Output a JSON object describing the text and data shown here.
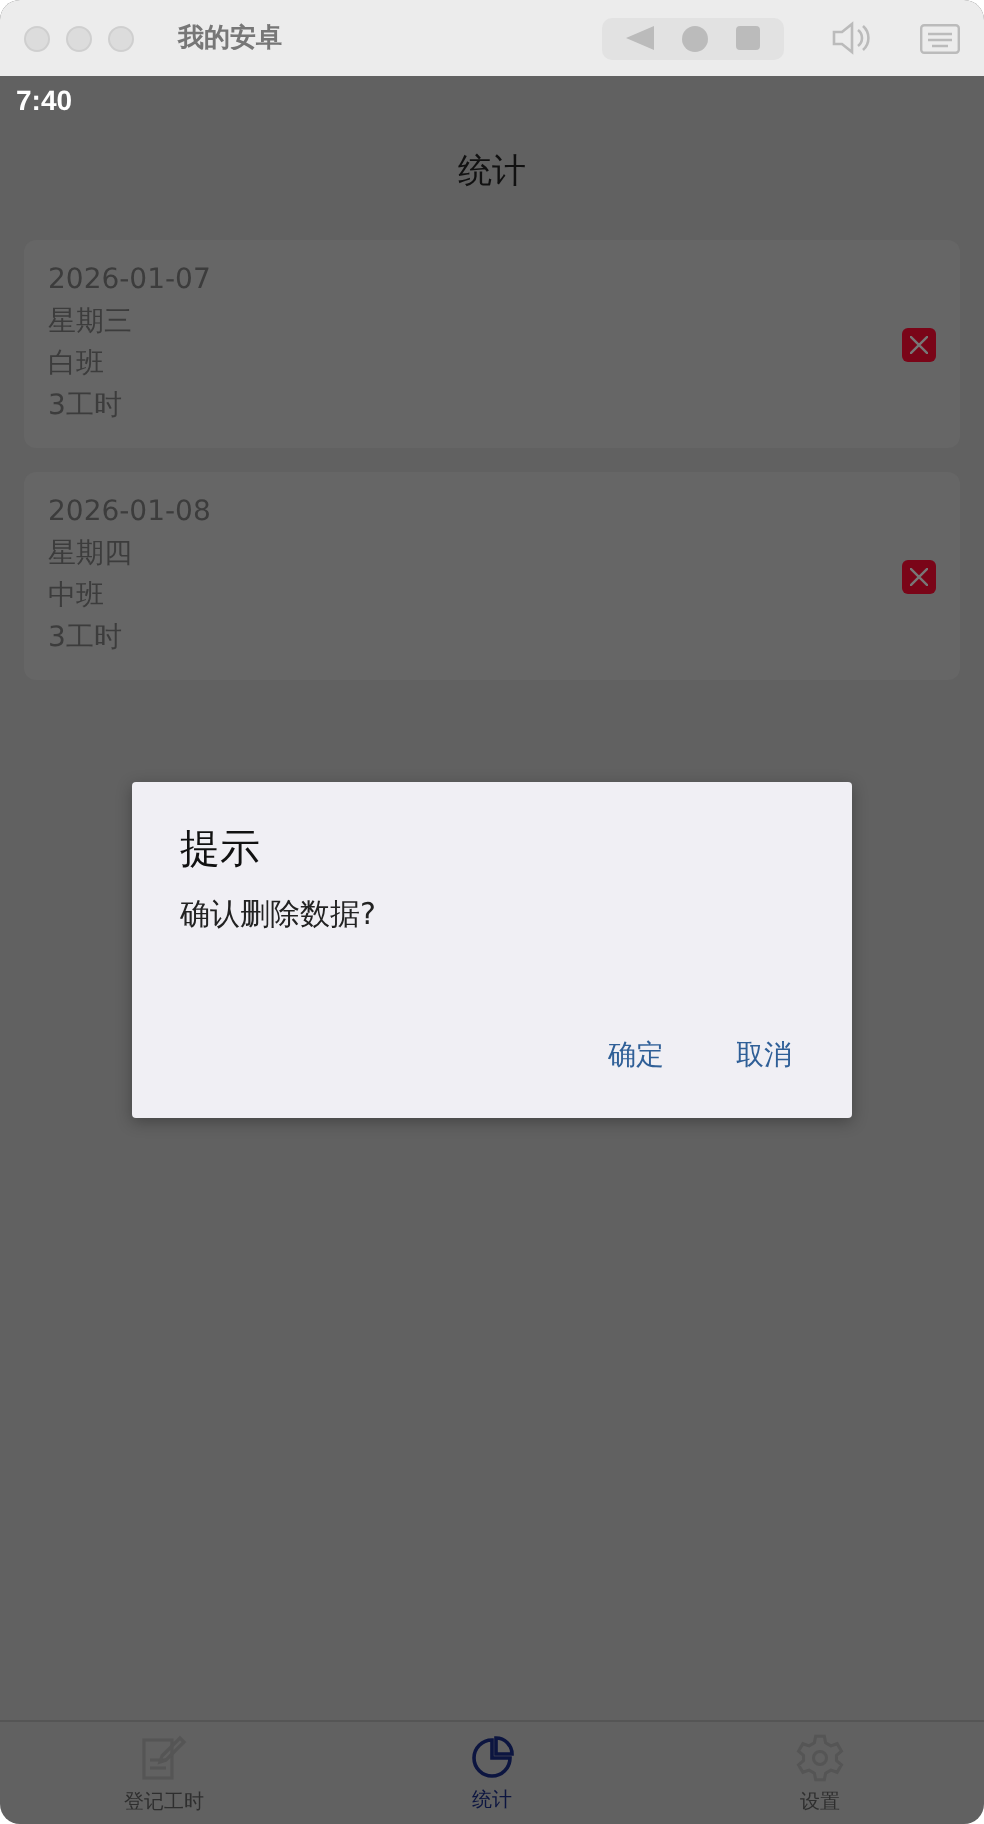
{
  "window": {
    "title": "我的安卓"
  },
  "status_bar": {
    "time": "7:40"
  },
  "header": {
    "title": "统计"
  },
  "records": [
    {
      "date": "2026-01-07",
      "weekday": "星期三",
      "shift": "白班",
      "hours": "3工时"
    },
    {
      "date": "2026-01-08",
      "weekday": "星期四",
      "shift": "中班",
      "hours": "3工时"
    }
  ],
  "dialog": {
    "title": "提示",
    "message": "确认删除数据?",
    "buttons": [
      "确定",
      "取消"
    ]
  },
  "tabs": [
    {
      "label": "登记工时",
      "kind": "register",
      "selected": false
    },
    {
      "label": "统计",
      "kind": "stats",
      "selected": true
    },
    {
      "label": "设置",
      "kind": "settings",
      "selected": false
    }
  ]
}
